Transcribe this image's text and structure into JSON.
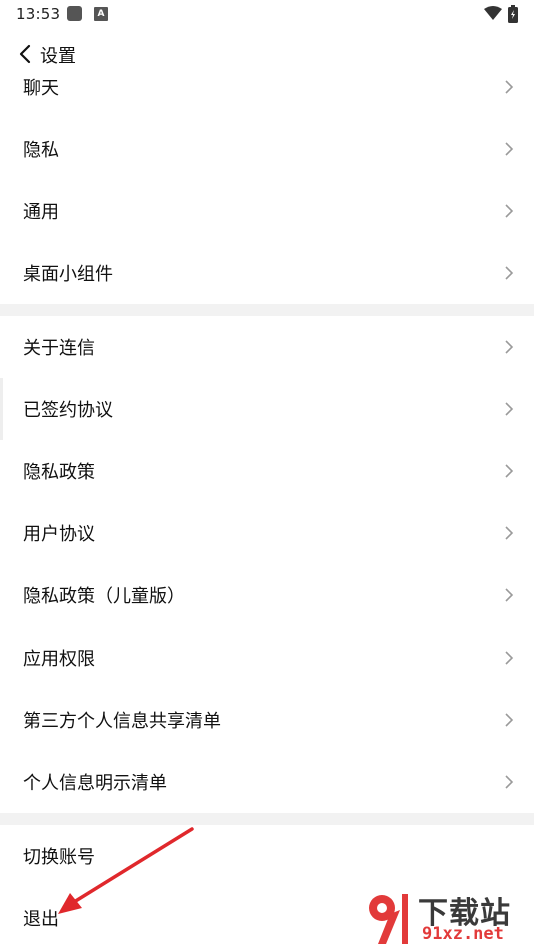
{
  "status_bar": {
    "time": "13:53",
    "a_badge": "A"
  },
  "header": {
    "title": "设置"
  },
  "sections": [
    {
      "items": [
        {
          "label": "聊天"
        },
        {
          "label": "隐私"
        },
        {
          "label": "通用"
        },
        {
          "label": "桌面小组件"
        }
      ]
    },
    {
      "items": [
        {
          "label": "关于连信"
        },
        {
          "label": "已签约协议"
        },
        {
          "label": "隐私政策"
        },
        {
          "label": "用户协议"
        },
        {
          "label": "隐私政策（儿童版）"
        },
        {
          "label": "应用权限"
        },
        {
          "label": "第三方个人信息共享清单"
        },
        {
          "label": "个人信息明示清单"
        }
      ]
    },
    {
      "items": [
        {
          "label": "切换账号"
        },
        {
          "label": "退出"
        }
      ]
    }
  ],
  "watermark": {
    "main": "下载站",
    "sub": "91xz.net"
  },
  "colors": {
    "background": "#ffffff",
    "divider": "#f2f2f2",
    "chevron": "#9a9a9a",
    "arrow": "#e0282c"
  }
}
